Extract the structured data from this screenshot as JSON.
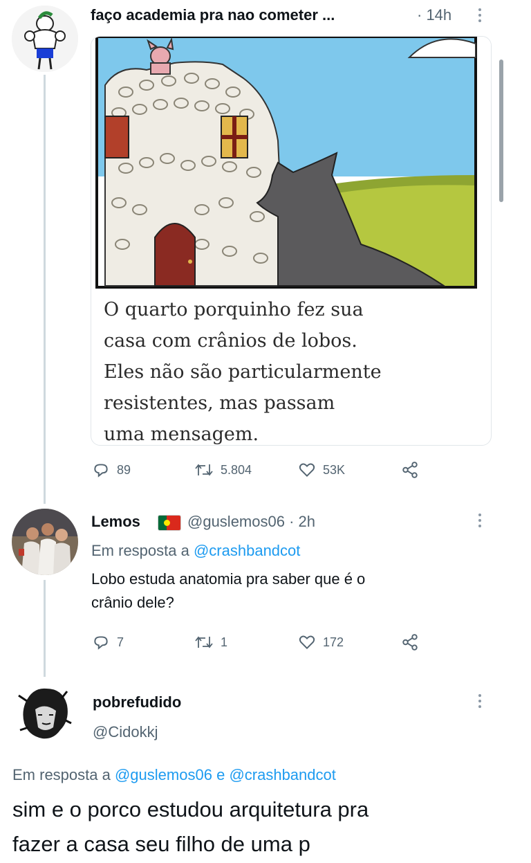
{
  "tweet1": {
    "author": "faço academia pra nao cometer ...",
    "time": "· 14h",
    "image_caption": [
      "O quarto porquinho fez sua",
      "casa com crânios de lobos.",
      "Eles não são particularmente",
      "resistentes, mas passam",
      "uma mensagem."
    ],
    "actions": {
      "replies": "89",
      "retweets": "5.804",
      "likes": "53K"
    }
  },
  "reply1": {
    "name": "Lemos",
    "flag": "🇵🇹",
    "handle_time": "@guslemos06 · 2h",
    "reply_prefix": "Em resposta a",
    "reply_user": "@crashbandcot",
    "text_lines": [
      "Lobo estuda anatomia pra saber que é o",
      "crânio dele?"
    ],
    "actions": {
      "replies": "7",
      "retweets": "1",
      "likes": "172"
    }
  },
  "reply2": {
    "name": "pobrefudido",
    "handle": "@Cidokkj",
    "reply_prefix": "Em resposta a",
    "reply_user1": "@guslemos06",
    "reply_and": "e",
    "reply_user2": "@crashbandcot",
    "text_lines": [
      "sim e o porco estudou arquitetura pra",
      "fazer a casa seu filho de uma p"
    ]
  },
  "colors": {
    "link": "#1d9bf0",
    "muted": "#536471",
    "thread": "#cfd9de"
  },
  "icons": [
    "reply-icon",
    "retweet-icon",
    "like-icon",
    "share-icon",
    "more-icon"
  ]
}
